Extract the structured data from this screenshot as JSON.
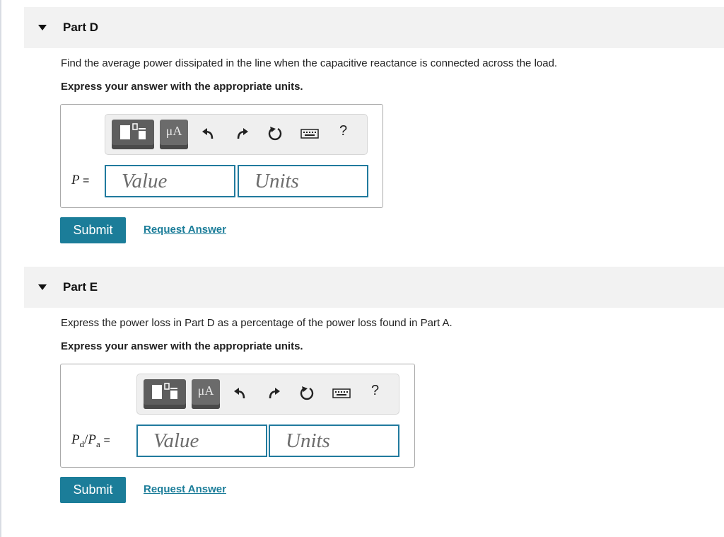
{
  "part_d": {
    "title": "Part D",
    "question": "Find the average power dissipated in the line when the capacitive reactance is connected across the load.",
    "instruction": "Express your answer with the appropriate units.",
    "toolbar": {
      "units_button": "μA",
      "help": "?",
      "icons": [
        "templates-icon",
        "units-icon",
        "undo-icon",
        "redo-icon",
        "reset-icon",
        "keyboard-icon",
        "help-icon"
      ]
    },
    "variable": "P",
    "equals": "=",
    "value_placeholder": "Value",
    "units_placeholder": "Units",
    "submit_label": "Submit",
    "request_label": "Request Answer"
  },
  "part_e": {
    "title": "Part E",
    "question": "Express the power loss in Part D as a percentage of the power loss found in Part A.",
    "instruction": "Express your answer with the appropriate units.",
    "toolbar": {
      "units_button": "μA",
      "help": "?"
    },
    "var_num": "P",
    "var_num_sub": "d",
    "slash": "/",
    "var_den": "P",
    "var_den_sub": "a",
    "equals": "=",
    "value_placeholder": "Value",
    "units_placeholder": "Units",
    "submit_label": "Submit",
    "request_label": "Request Answer"
  }
}
